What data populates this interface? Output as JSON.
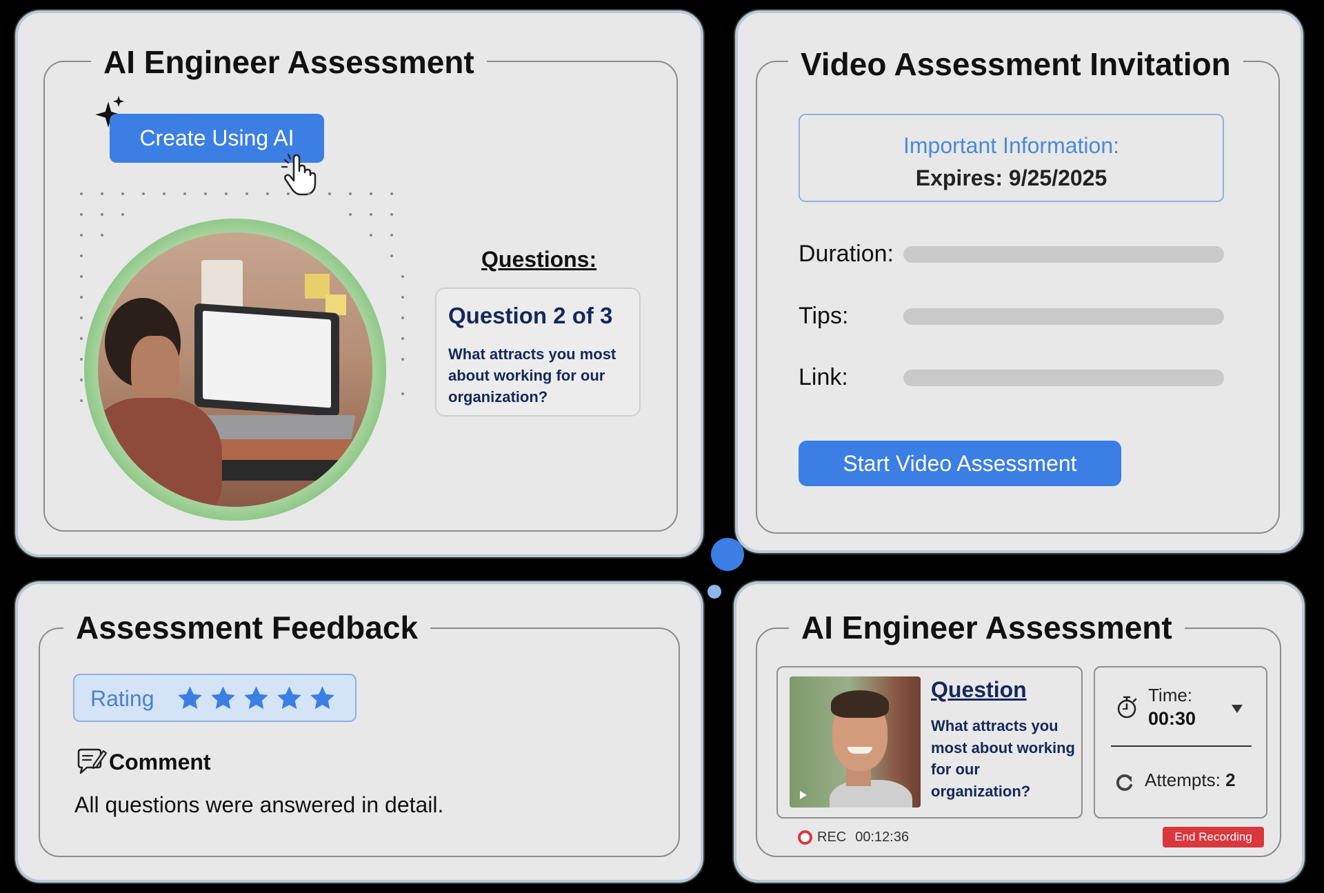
{
  "assessment_builder": {
    "title": "AI Engineer Assessment",
    "create_button": "Create Using AI",
    "questions_heading": "Questions:",
    "question_counter": "Question 2 of 3",
    "question_text": "What attracts you most about working for our organization?"
  },
  "invitation": {
    "title": "Video Assessment Invitation",
    "info_heading": "Important Information:",
    "expires": "Expires: 9/25/2025",
    "fields": [
      {
        "label": "Duration:"
      },
      {
        "label": "Tips:"
      },
      {
        "label": "Link:"
      }
    ],
    "start_button": "Start Video Assessment"
  },
  "feedback": {
    "title": "Assessment Feedback",
    "rating_label": "Rating",
    "rating_value": 5,
    "rating_max": 5,
    "comment_heading": "Comment",
    "comment_text": "All questions were answered in detail."
  },
  "recording": {
    "title": "AI Engineer Assessment",
    "question_heading": "Question",
    "question_text": "What attracts you most about working for our organization?",
    "time_label": "Time:",
    "time_value": "00:30",
    "attempts_label": "Attempts:",
    "attempts_value": "2",
    "rec_label": "REC",
    "rec_time": "00:12:36",
    "end_button": "End Recording"
  },
  "colors": {
    "accent_blue": "#3b7ee4",
    "navy_text": "#14285a",
    "card_bg": "#e8e8e8",
    "rec_red": "#d9363e",
    "ring_green": "#6db766"
  }
}
